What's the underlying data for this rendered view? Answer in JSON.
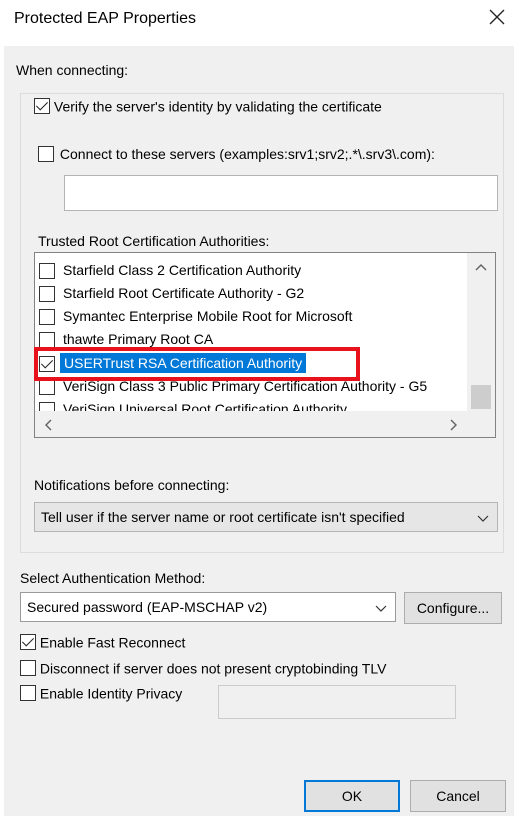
{
  "window": {
    "title": "Protected EAP Properties"
  },
  "when_connecting_label": "When connecting:",
  "verify_server": {
    "label": "Verify the server's identity by validating the certificate",
    "checked": true
  },
  "connect_servers": {
    "label": "Connect to these servers (examples:srv1;srv2;.*\\.srv3\\.com):",
    "checked": false,
    "value": ""
  },
  "trusted_root": {
    "label": "Trusted Root Certification Authorities:",
    "items": [
      {
        "label": "Starfield Class 2 Certification Authority",
        "checked": false
      },
      {
        "label": "Starfield Root Certificate Authority - G2",
        "checked": false
      },
      {
        "label": "Symantec Enterprise Mobile Root for Microsoft",
        "checked": false
      },
      {
        "label": "thawte Primary Root CA",
        "checked": false
      },
      {
        "label": "USERTrust RSA Certification Authority",
        "checked": true,
        "selected": true
      },
      {
        "label": "VeriSign Class 3 Public Primary Certification Authority - G5",
        "checked": false
      },
      {
        "label": "VeriSign Universal Root Certification Authority",
        "checked": false
      }
    ]
  },
  "notifications": {
    "label": "Notifications before connecting:",
    "selected": "Tell user if the server name or root certificate isn't specified"
  },
  "auth_method": {
    "label": "Select Authentication Method:",
    "selected": "Secured password (EAP-MSCHAP v2)",
    "configure_label": "Configure..."
  },
  "options": {
    "fast_reconnect": {
      "label": "Enable Fast Reconnect",
      "checked": true
    },
    "cryptobinding": {
      "label": "Disconnect if server does not present cryptobinding TLV",
      "checked": false
    },
    "identity_privacy": {
      "label": "Enable Identity Privacy",
      "checked": false,
      "value": ""
    }
  },
  "buttons": {
    "ok": "OK",
    "cancel": "Cancel"
  },
  "colors": {
    "accent": "#0078d7",
    "highlight": "#e8111c",
    "dialog_bg": "#f0f0f0"
  }
}
